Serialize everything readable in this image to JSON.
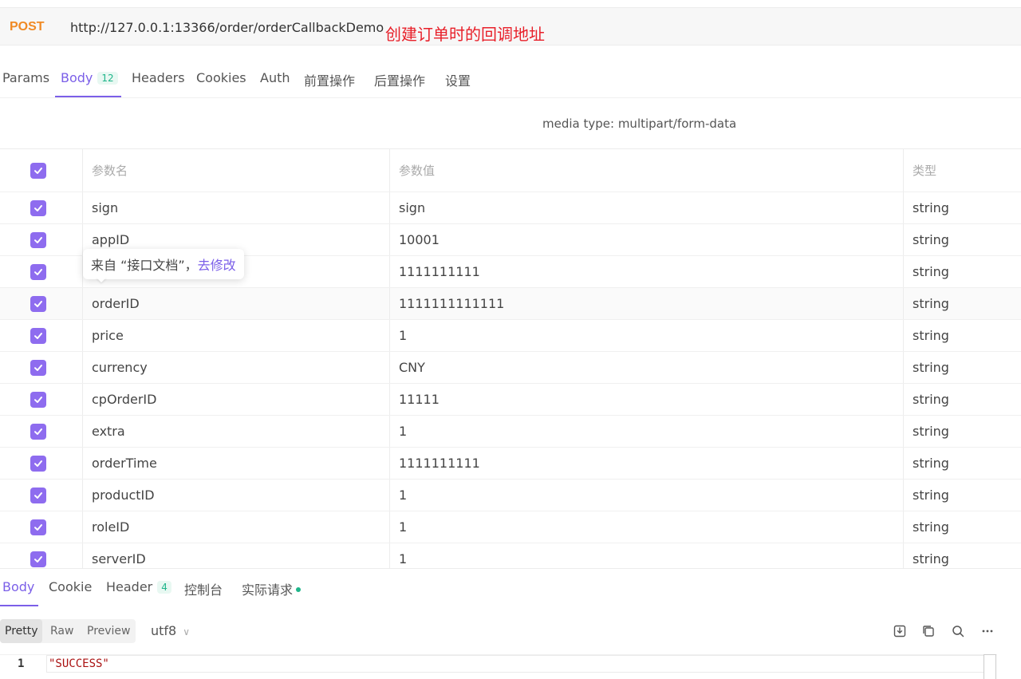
{
  "request": {
    "method": "POST",
    "url": "http://127.0.0.1:13366/order/orderCallbackDemo",
    "annotation": "创建订单时的回调地址"
  },
  "tabs": [
    {
      "label": "Params"
    },
    {
      "label": "Body",
      "badge": "12",
      "active": true
    },
    {
      "label": "Headers"
    },
    {
      "label": "Cookies"
    },
    {
      "label": "Auth"
    },
    {
      "label": "前置操作"
    },
    {
      "label": "后置操作"
    },
    {
      "label": "设置"
    }
  ],
  "media_type": "media type: multipart/form-data",
  "table": {
    "headers": {
      "name": "参数名",
      "value": "参数值",
      "type": "类型"
    },
    "rows": [
      {
        "name": "sign",
        "value": "sign",
        "type": "string"
      },
      {
        "name": "appID",
        "value": "10001",
        "type": "string"
      },
      {
        "name": "",
        "value": "1111111111",
        "type": "string"
      },
      {
        "name": "orderID",
        "value": "1111111111111",
        "type": "string"
      },
      {
        "name": "price",
        "value": "1",
        "type": "string"
      },
      {
        "name": "currency",
        "value": "CNY",
        "type": "string"
      },
      {
        "name": "cpOrderID",
        "value": "11111",
        "type": "string"
      },
      {
        "name": "extra",
        "value": "1",
        "type": "string"
      },
      {
        "name": "orderTime",
        "value": "1111111111",
        "type": "string"
      },
      {
        "name": "productID",
        "value": "1",
        "type": "string"
      },
      {
        "name": "roleID",
        "value": "1",
        "type": "string"
      },
      {
        "name": "serverID",
        "value": "1",
        "type": "string"
      }
    ]
  },
  "tooltip": {
    "text": "来自 “接口文档”，",
    "link": "去修改"
  },
  "response": {
    "tabs": [
      {
        "label": "Body",
        "active": true
      },
      {
        "label": "Cookie"
      },
      {
        "label": "Header",
        "badge": "4"
      },
      {
        "label": "控制台"
      },
      {
        "label": "实际请求",
        "dot": true
      }
    ],
    "view_modes": [
      "Pretty",
      "Raw",
      "Preview"
    ],
    "encoding": "utf8",
    "line_number": "1",
    "body": "\"SUCCESS\""
  },
  "colors": {
    "accent": "#7b5fe8",
    "method": "#f08a24",
    "annotation": "#e8202a",
    "badge": "#1fb58a"
  },
  "icons": [
    "check-icon",
    "download-icon",
    "copy-icon",
    "search-icon",
    "more-icon",
    "chevron-down-icon"
  ]
}
